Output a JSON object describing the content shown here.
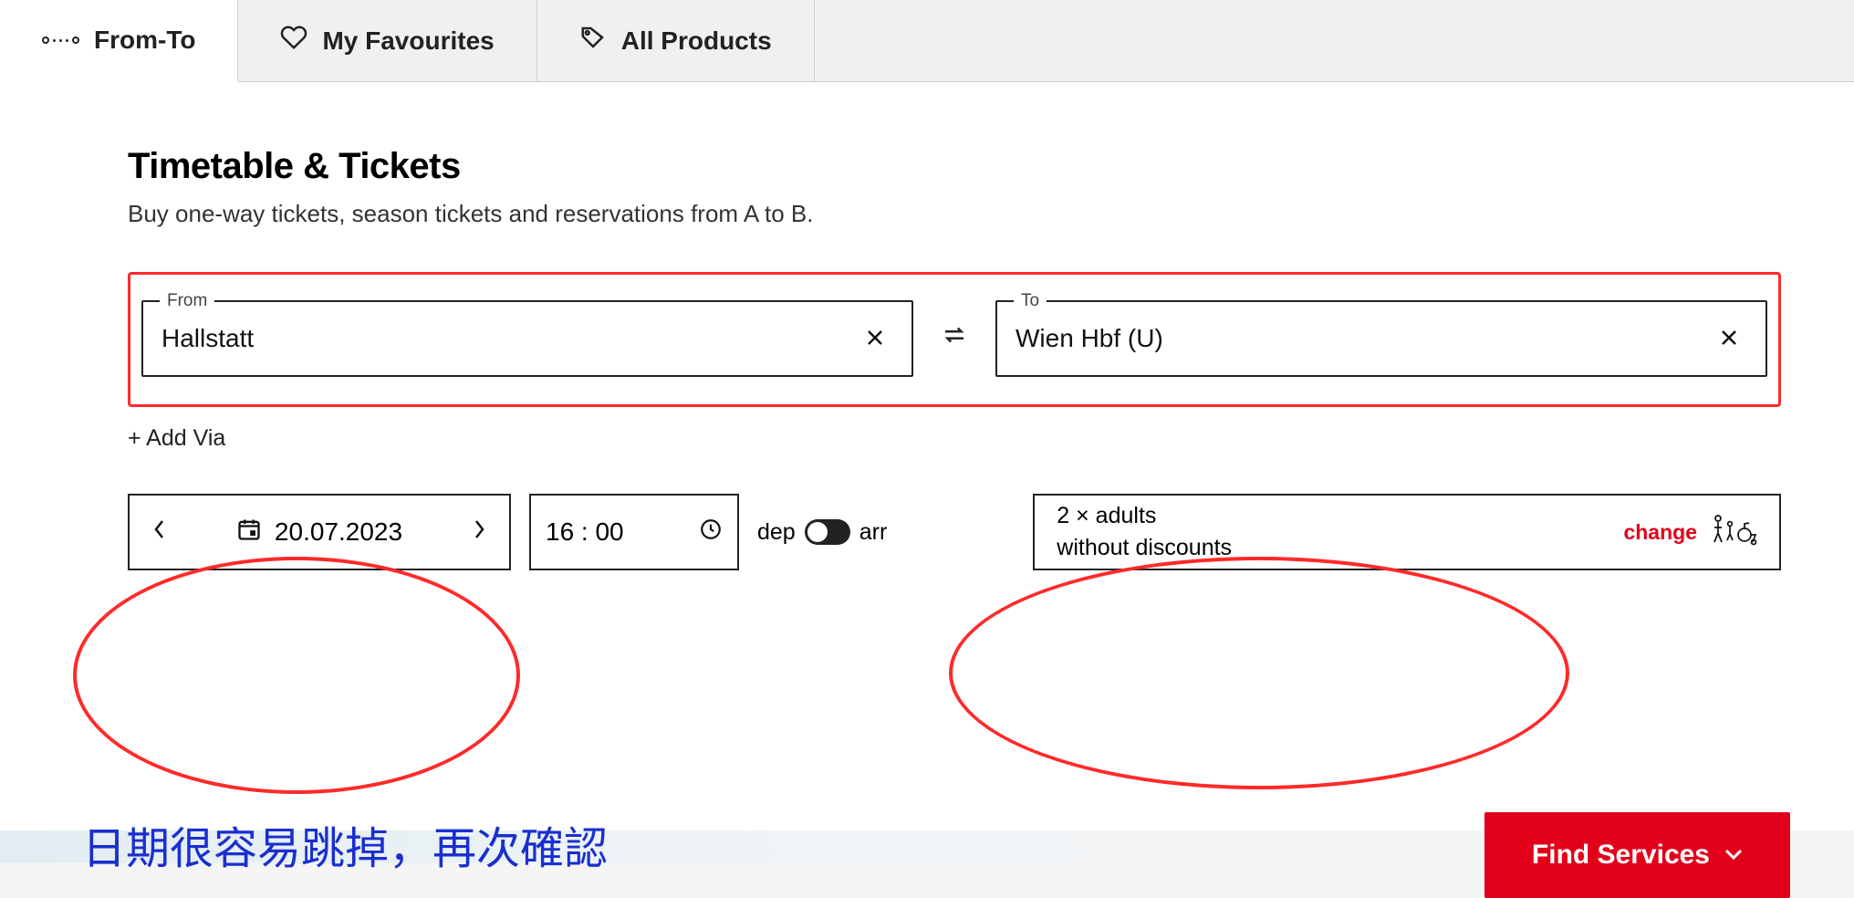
{
  "tabs": {
    "from_to": "From-To",
    "favourites": "My Favourites",
    "all_products": "All Products"
  },
  "header": {
    "title": "Timetable & Tickets",
    "subtitle": "Buy one-way tickets, season tickets and reservations from A to B."
  },
  "from": {
    "label": "From",
    "value": "Hallstatt"
  },
  "to": {
    "label": "To",
    "value": "Wien Hbf (U)"
  },
  "add_via": "+ Add Via",
  "date": {
    "value": "20.07.2023"
  },
  "time": {
    "value": "16 : 00"
  },
  "dep_arr": {
    "dep": "dep",
    "arr": "arr"
  },
  "passengers": {
    "line1": "2 × adults",
    "line2": "without discounts",
    "change": "change"
  },
  "cta": {
    "find": "Find Services"
  },
  "annotation": "日期很容易跳掉，再次確認"
}
